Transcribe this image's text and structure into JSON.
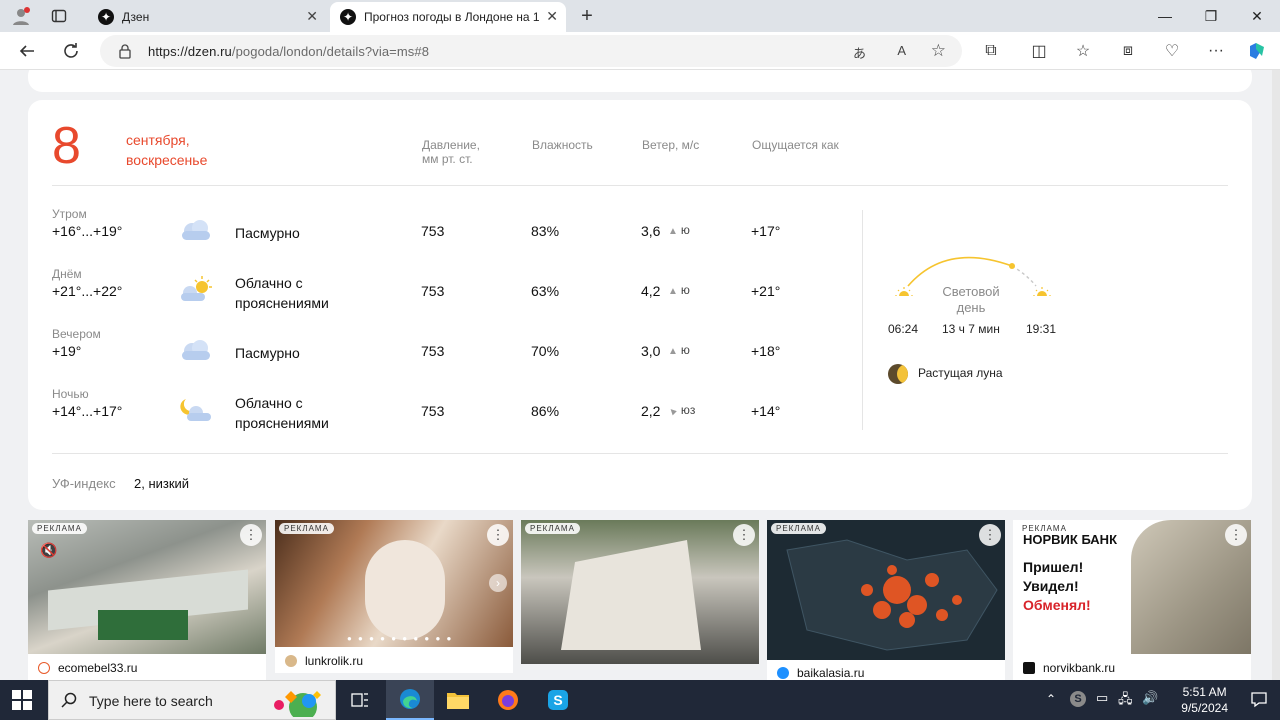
{
  "browser": {
    "tabs": [
      {
        "title": "Дзен",
        "active": false
      },
      {
        "title": "Прогноз погоды в Лондоне на 1",
        "active": true
      }
    ],
    "url_host": "https://dzen.ru",
    "url_path": "/pogoda/london/details?via=ms#8"
  },
  "weather": {
    "day_number": "8",
    "day_line1": "сентября,",
    "day_line2": "воскресенье",
    "columns": {
      "pressure_line1": "Давление,",
      "pressure_line2": "мм рт. ст.",
      "humidity": "Влажность",
      "wind": "Ветер, м/с",
      "feels": "Ощущается как"
    },
    "rows": [
      {
        "period": "Утром",
        "temps": "+16°...+19°",
        "icon": "cloud-icon",
        "cond1": "Пасмурно",
        "cond2": "",
        "pressure": "753",
        "humidity": "83%",
        "wind": "3,6",
        "wind_dir": "ю",
        "feels": "+17°"
      },
      {
        "period": "Днём",
        "temps": "+21°...+22°",
        "icon": "partly-cloudy-day-icon",
        "cond1": "Облачно с",
        "cond2": "прояснениями",
        "pressure": "753",
        "humidity": "63%",
        "wind": "4,2",
        "wind_dir": "ю",
        "feels": "+21°"
      },
      {
        "period": "Вечером",
        "temps": "+19°",
        "icon": "cloud-icon",
        "cond1": "Пасмурно",
        "cond2": "",
        "pressure": "753",
        "humidity": "70%",
        "wind": "3,0",
        "wind_dir": "ю",
        "feels": "+18°"
      },
      {
        "period": "Ночью",
        "temps": "+14°...+17°",
        "icon": "partly-cloudy-night-icon",
        "cond1": "Облачно с",
        "cond2": "прояснениями",
        "pressure": "753",
        "humidity": "86%",
        "wind": "2,2",
        "wind_dir": "юз",
        "feels": "+14°"
      }
    ],
    "daylight": {
      "title_line1": "Световой",
      "title_line2": "день",
      "sunrise": "06:24",
      "duration": "13 ч 7 мин",
      "sunset": "19:31"
    },
    "moon": "Растущая луна",
    "uv_label": "УФ-индекс",
    "uv_value": "2, низкий"
  },
  "ads": [
    {
      "badge": "РЕКЛАМА",
      "domain": "ecomebel33.ru"
    },
    {
      "badge": "РЕКЛАМА",
      "domain": "lunkrolik.ru"
    },
    {
      "badge": "РЕКЛАМА",
      "domain": ""
    },
    {
      "badge": "РЕКЛАМА",
      "domain": "baikalasia.ru"
    },
    {
      "badge": "РЕКЛАМА",
      "domain": "norvikbank.ru",
      "brand": "НОРВИК БАНК",
      "headline1": "Пришел!",
      "headline2": "Увидел!",
      "headline3": "Обменял!"
    }
  ],
  "taskbar": {
    "search_placeholder": "Type here to search",
    "time": "5:51 AM",
    "date": "9/5/2024"
  },
  "colors": {
    "accent_red": "#e8492d",
    "card_bg": "#ffffff",
    "page_bg": "#f0f1f3",
    "taskbar_bg": "#202838"
  }
}
